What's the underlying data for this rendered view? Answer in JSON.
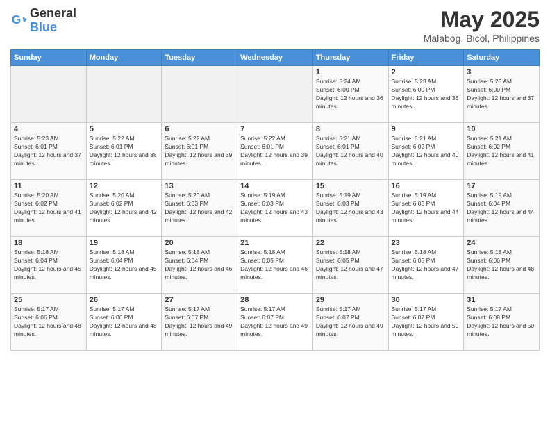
{
  "header": {
    "logo_line1": "General",
    "logo_line2": "Blue",
    "month": "May 2025",
    "location": "Malabog, Bicol, Philippines"
  },
  "days_of_week": [
    "Sunday",
    "Monday",
    "Tuesday",
    "Wednesday",
    "Thursday",
    "Friday",
    "Saturday"
  ],
  "weeks": [
    [
      {
        "day": "",
        "empty": true
      },
      {
        "day": "",
        "empty": true
      },
      {
        "day": "",
        "empty": true
      },
      {
        "day": "",
        "empty": true
      },
      {
        "day": "1",
        "sunrise": "5:24 AM",
        "sunset": "6:00 PM",
        "daylight": "12 hours and 36 minutes."
      },
      {
        "day": "2",
        "sunrise": "5:23 AM",
        "sunset": "6:00 PM",
        "daylight": "12 hours and 36 minutes."
      },
      {
        "day": "3",
        "sunrise": "5:23 AM",
        "sunset": "6:00 PM",
        "daylight": "12 hours and 37 minutes."
      }
    ],
    [
      {
        "day": "4",
        "sunrise": "5:23 AM",
        "sunset": "6:01 PM",
        "daylight": "12 hours and 37 minutes."
      },
      {
        "day": "5",
        "sunrise": "5:22 AM",
        "sunset": "6:01 PM",
        "daylight": "12 hours and 38 minutes."
      },
      {
        "day": "6",
        "sunrise": "5:22 AM",
        "sunset": "6:01 PM",
        "daylight": "12 hours and 39 minutes."
      },
      {
        "day": "7",
        "sunrise": "5:22 AM",
        "sunset": "6:01 PM",
        "daylight": "12 hours and 39 minutes."
      },
      {
        "day": "8",
        "sunrise": "5:21 AM",
        "sunset": "6:01 PM",
        "daylight": "12 hours and 40 minutes."
      },
      {
        "day": "9",
        "sunrise": "5:21 AM",
        "sunset": "6:02 PM",
        "daylight": "12 hours and 40 minutes."
      },
      {
        "day": "10",
        "sunrise": "5:21 AM",
        "sunset": "6:02 PM",
        "daylight": "12 hours and 41 minutes."
      }
    ],
    [
      {
        "day": "11",
        "sunrise": "5:20 AM",
        "sunset": "6:02 PM",
        "daylight": "12 hours and 41 minutes."
      },
      {
        "day": "12",
        "sunrise": "5:20 AM",
        "sunset": "6:02 PM",
        "daylight": "12 hours and 42 minutes."
      },
      {
        "day": "13",
        "sunrise": "5:20 AM",
        "sunset": "6:03 PM",
        "daylight": "12 hours and 42 minutes."
      },
      {
        "day": "14",
        "sunrise": "5:19 AM",
        "sunset": "6:03 PM",
        "daylight": "12 hours and 43 minutes."
      },
      {
        "day": "15",
        "sunrise": "5:19 AM",
        "sunset": "6:03 PM",
        "daylight": "12 hours and 43 minutes."
      },
      {
        "day": "16",
        "sunrise": "5:19 AM",
        "sunset": "6:03 PM",
        "daylight": "12 hours and 44 minutes."
      },
      {
        "day": "17",
        "sunrise": "5:19 AM",
        "sunset": "6:04 PM",
        "daylight": "12 hours and 44 minutes."
      }
    ],
    [
      {
        "day": "18",
        "sunrise": "5:18 AM",
        "sunset": "6:04 PM",
        "daylight": "12 hours and 45 minutes."
      },
      {
        "day": "19",
        "sunrise": "5:18 AM",
        "sunset": "6:04 PM",
        "daylight": "12 hours and 45 minutes."
      },
      {
        "day": "20",
        "sunrise": "5:18 AM",
        "sunset": "6:04 PM",
        "daylight": "12 hours and 46 minutes."
      },
      {
        "day": "21",
        "sunrise": "5:18 AM",
        "sunset": "6:05 PM",
        "daylight": "12 hours and 46 minutes."
      },
      {
        "day": "22",
        "sunrise": "5:18 AM",
        "sunset": "6:05 PM",
        "daylight": "12 hours and 47 minutes."
      },
      {
        "day": "23",
        "sunrise": "5:18 AM",
        "sunset": "6:05 PM",
        "daylight": "12 hours and 47 minutes."
      },
      {
        "day": "24",
        "sunrise": "5:18 AM",
        "sunset": "6:06 PM",
        "daylight": "12 hours and 48 minutes."
      }
    ],
    [
      {
        "day": "25",
        "sunrise": "5:17 AM",
        "sunset": "6:06 PM",
        "daylight": "12 hours and 48 minutes."
      },
      {
        "day": "26",
        "sunrise": "5:17 AM",
        "sunset": "6:06 PM",
        "daylight": "12 hours and 48 minutes."
      },
      {
        "day": "27",
        "sunrise": "5:17 AM",
        "sunset": "6:07 PM",
        "daylight": "12 hours and 49 minutes."
      },
      {
        "day": "28",
        "sunrise": "5:17 AM",
        "sunset": "6:07 PM",
        "daylight": "12 hours and 49 minutes."
      },
      {
        "day": "29",
        "sunrise": "5:17 AM",
        "sunset": "6:07 PM",
        "daylight": "12 hours and 49 minutes."
      },
      {
        "day": "30",
        "sunrise": "5:17 AM",
        "sunset": "6:07 PM",
        "daylight": "12 hours and 50 minutes."
      },
      {
        "day": "31",
        "sunrise": "5:17 AM",
        "sunset": "6:08 PM",
        "daylight": "12 hours and 50 minutes."
      }
    ]
  ]
}
